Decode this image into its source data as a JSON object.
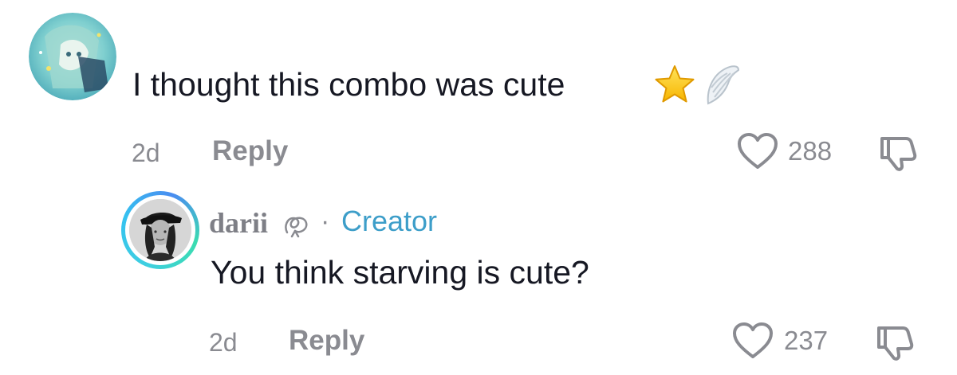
{
  "comment": {
    "text": "I thought this combo was cute",
    "emojis": [
      "star-emoji",
      "wing-emoji"
    ],
    "time": "2d",
    "reply_label": "Reply",
    "likes": "288"
  },
  "reply": {
    "username": "darii",
    "separator": "·",
    "badge": "Creator",
    "text": "You think starving is cute?",
    "time": "2d",
    "reply_label": "Reply",
    "likes": "237"
  },
  "colors": {
    "meta_gray": "#8a8b91",
    "creator_blue": "#3d9ec9",
    "text_dark": "#161823",
    "avatar_ring": "#3ecfe0"
  },
  "icons": {
    "heart": "heart-outline-icon",
    "dislike": "thumbs-down-icon",
    "knot": "knot-icon"
  }
}
